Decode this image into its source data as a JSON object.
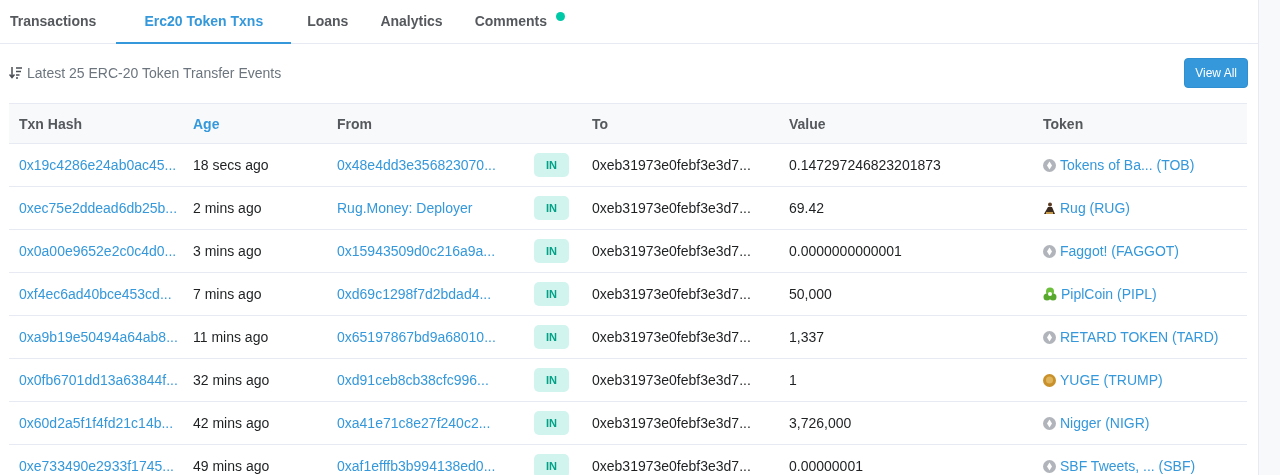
{
  "tabs": [
    {
      "label": "Transactions",
      "selected": false,
      "dot": false
    },
    {
      "label": "Erc20 Token Txns",
      "selected": true,
      "dot": false
    },
    {
      "label": "Loans",
      "selected": false,
      "dot": false
    },
    {
      "label": "Analytics",
      "selected": false,
      "dot": false
    },
    {
      "label": "Comments",
      "selected": false,
      "dot": true
    }
  ],
  "heading": "Latest 25 ERC-20 Token Transfer Events",
  "view_all": "View All",
  "table": {
    "columns": [
      {
        "label": "Txn Hash",
        "sortable": false
      },
      {
        "label": "Age",
        "sortable": true
      },
      {
        "label": "From",
        "sortable": false
      },
      {
        "label": "To",
        "sortable": false
      },
      {
        "label": "Value",
        "sortable": false
      },
      {
        "label": "Token",
        "sortable": false
      }
    ],
    "rows": [
      {
        "hash": "0x19c4286e24ab0ac45...",
        "age": "18 secs ago",
        "from": "0x48e4dd3e356823070...",
        "direction": "IN",
        "to": "0xeb31973e0febf3e3d7...",
        "value": "0.147297246823201873",
        "token": "Tokens of Ba... (TOB)",
        "token_icon": {
          "kind": "generic"
        }
      },
      {
        "hash": "0xec75e2ddead6db25b...",
        "age": "2 mins ago",
        "from": "Rug.Money: Deployer",
        "direction": "IN",
        "to": "0xeb31973e0febf3e3d7...",
        "value": "69.42",
        "token": "Rug (RUG)",
        "token_icon": {
          "kind": "figure"
        }
      },
      {
        "hash": "0x0a00e9652e2c0c4d0...",
        "age": "3 mins ago",
        "from": "0x15943509d0c216a9a...",
        "direction": "IN",
        "to": "0xeb31973e0febf3e3d7...",
        "value": "0.0000000000001",
        "token": "Faggot! (FAGGOT)",
        "token_icon": {
          "kind": "generic"
        }
      },
      {
        "hash": "0xf4ec6ad40bce453cd...",
        "age": "7 mins ago",
        "from": "0xd69c1298f7d2bdad4...",
        "direction": "IN",
        "to": "0xeb31973e0febf3e3d7...",
        "value": "50,000",
        "token": "PiplCoin (PIPL)",
        "token_icon": {
          "kind": "green"
        }
      },
      {
        "hash": "0xa9b19e50494a64ab8...",
        "age": "11 mins ago",
        "from": "0x65197867bd9a68010...",
        "direction": "IN",
        "to": "0xeb31973e0febf3e3d7...",
        "value": "1,337",
        "token": "RETARD TOKEN (TARD)",
        "token_icon": {
          "kind": "generic"
        }
      },
      {
        "hash": "0x0fb6701dd13a63844f...",
        "age": "32 mins ago",
        "from": "0xd91ceb8cb38cfc996...",
        "direction": "IN",
        "to": "0xeb31973e0febf3e3d7...",
        "value": "1",
        "token": "YUGE (TRUMP)",
        "token_icon": {
          "kind": "gold"
        }
      },
      {
        "hash": "0x60d2a5f1f4fd21c14b...",
        "age": "42 mins ago",
        "from": "0xa41e71c8e27f240c2...",
        "direction": "IN",
        "to": "0xeb31973e0febf3e3d7...",
        "value": "3,726,000",
        "token": "Nigger (NIGR)",
        "token_icon": {
          "kind": "generic"
        }
      },
      {
        "hash": "0xe733490e2933f1745...",
        "age": "49 mins ago",
        "from": "0xaf1efffb3b994138ed0...",
        "direction": "IN",
        "to": "0xeb31973e0febf3e3d7...",
        "value": "0.00000001",
        "token": "SBF Tweets, ... (SBF)",
        "token_icon": {
          "kind": "generic"
        }
      }
    ]
  }
}
